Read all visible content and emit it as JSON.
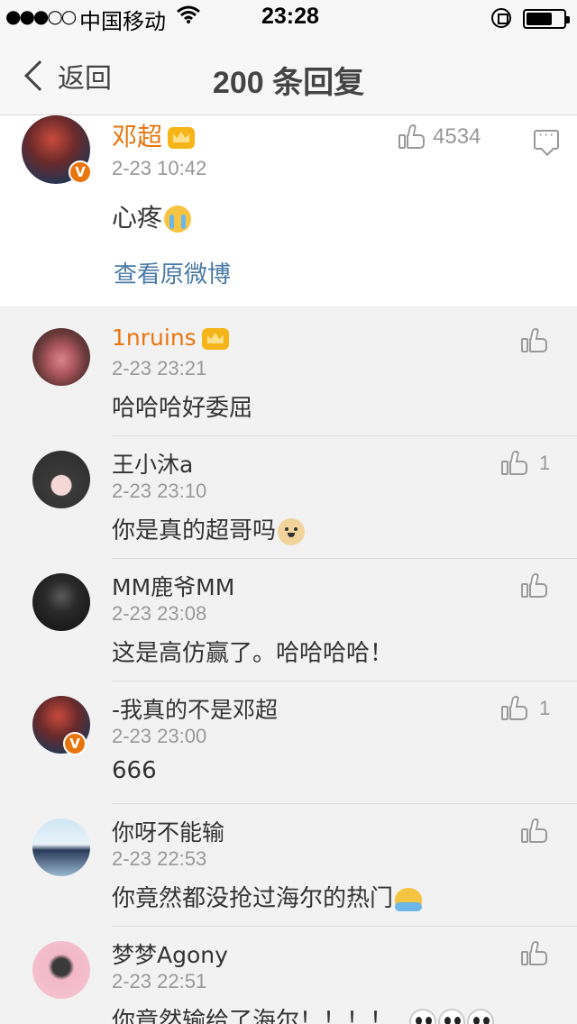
{
  "status_bar": {
    "signal": "●●●○○",
    "carrier": "中国移动",
    "time": "23:28",
    "battery_level": 0.7
  },
  "nav": {
    "back_label": "返回",
    "title": "200 条回复"
  },
  "original_post": {
    "author": "邓超",
    "time": "2-23 10:42",
    "text": "心疼",
    "likes": "4534",
    "view_original": "查看原微博"
  },
  "replies": [
    {
      "name": "1nruins",
      "time": "2-23 23:21",
      "text": "哈哈哈好委屈",
      "likes": ""
    },
    {
      "name": "王小沐a",
      "time": "2-23 23:10",
      "text": "你是真的超哥吗",
      "likes": "1"
    },
    {
      "name": "MM鹿爷MM",
      "time": "2-23 23:08",
      "text": "这是高仿赢了。哈哈哈哈！",
      "likes": ""
    },
    {
      "name": "-我真的不是邓超",
      "time": "2-23 23:00",
      "text": "666",
      "likes": "1"
    },
    {
      "name": "你呀不能输",
      "time": "2-23 22:53",
      "text": "你竟然都没抢过海尔的热门",
      "likes": ""
    },
    {
      "name": "梦梦Agony",
      "time": "2-23 22:51",
      "text": "你竟然输给了海尔！！！！",
      "likes": ""
    }
  ],
  "colors": {
    "vip_name": "#e8760f",
    "link": "#4a7aa5",
    "meta": "#999999"
  }
}
